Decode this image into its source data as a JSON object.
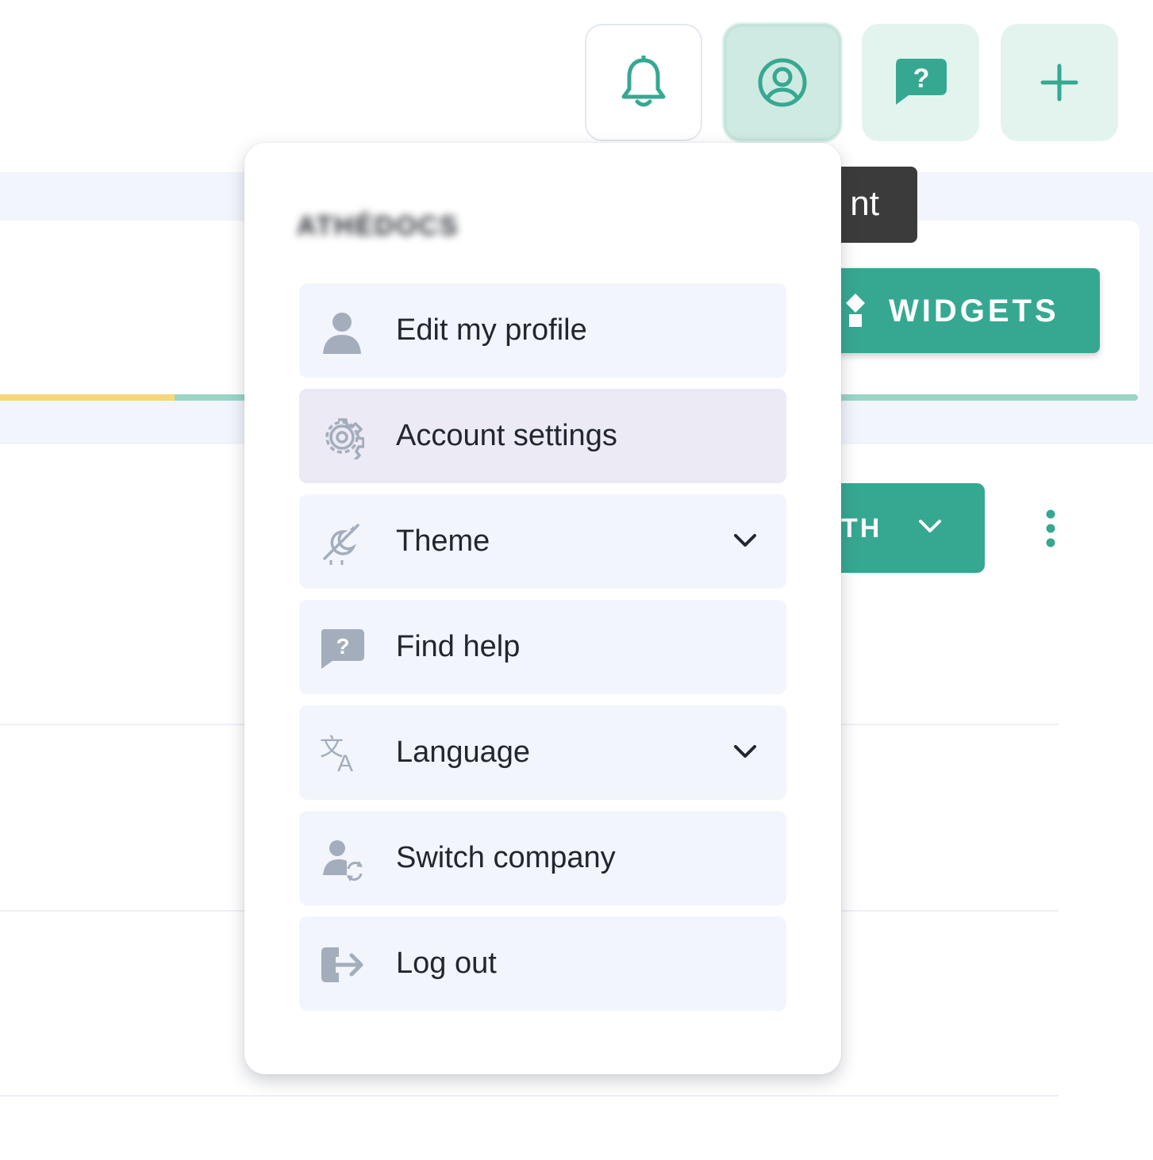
{
  "topbar": {
    "buttons": [
      {
        "name": "notifications",
        "icon": "bell-icon"
      },
      {
        "name": "account",
        "icon": "user-circle-icon"
      },
      {
        "name": "help",
        "icon": "help-bubble-icon"
      },
      {
        "name": "add",
        "icon": "plus-icon"
      }
    ]
  },
  "colors": {
    "accent": "#36a891",
    "accent_light": "#e3f4ef",
    "menu_item_bg": "#f2f5fc",
    "menu_icon": "#a3adbb"
  },
  "background": {
    "tooltip_text": "nt",
    "widgets_label": "WIDGETS",
    "period_label": "TH",
    "progress_fraction": 0.15
  },
  "menu": {
    "username": "ATHÉDOCS",
    "items": [
      {
        "label": "Edit my profile",
        "icon": "user-icon"
      },
      {
        "label": "Account settings",
        "icon": "gear-icon"
      },
      {
        "label": "Theme",
        "icon": "theme-icon",
        "has_submenu": true
      },
      {
        "label": "Find help",
        "icon": "help-bubble-icon"
      },
      {
        "label": "Language",
        "icon": "translate-icon",
        "has_submenu": true
      },
      {
        "label": "Switch company",
        "icon": "switch-user-icon"
      },
      {
        "label": "Log out",
        "icon": "logout-icon"
      }
    ]
  }
}
